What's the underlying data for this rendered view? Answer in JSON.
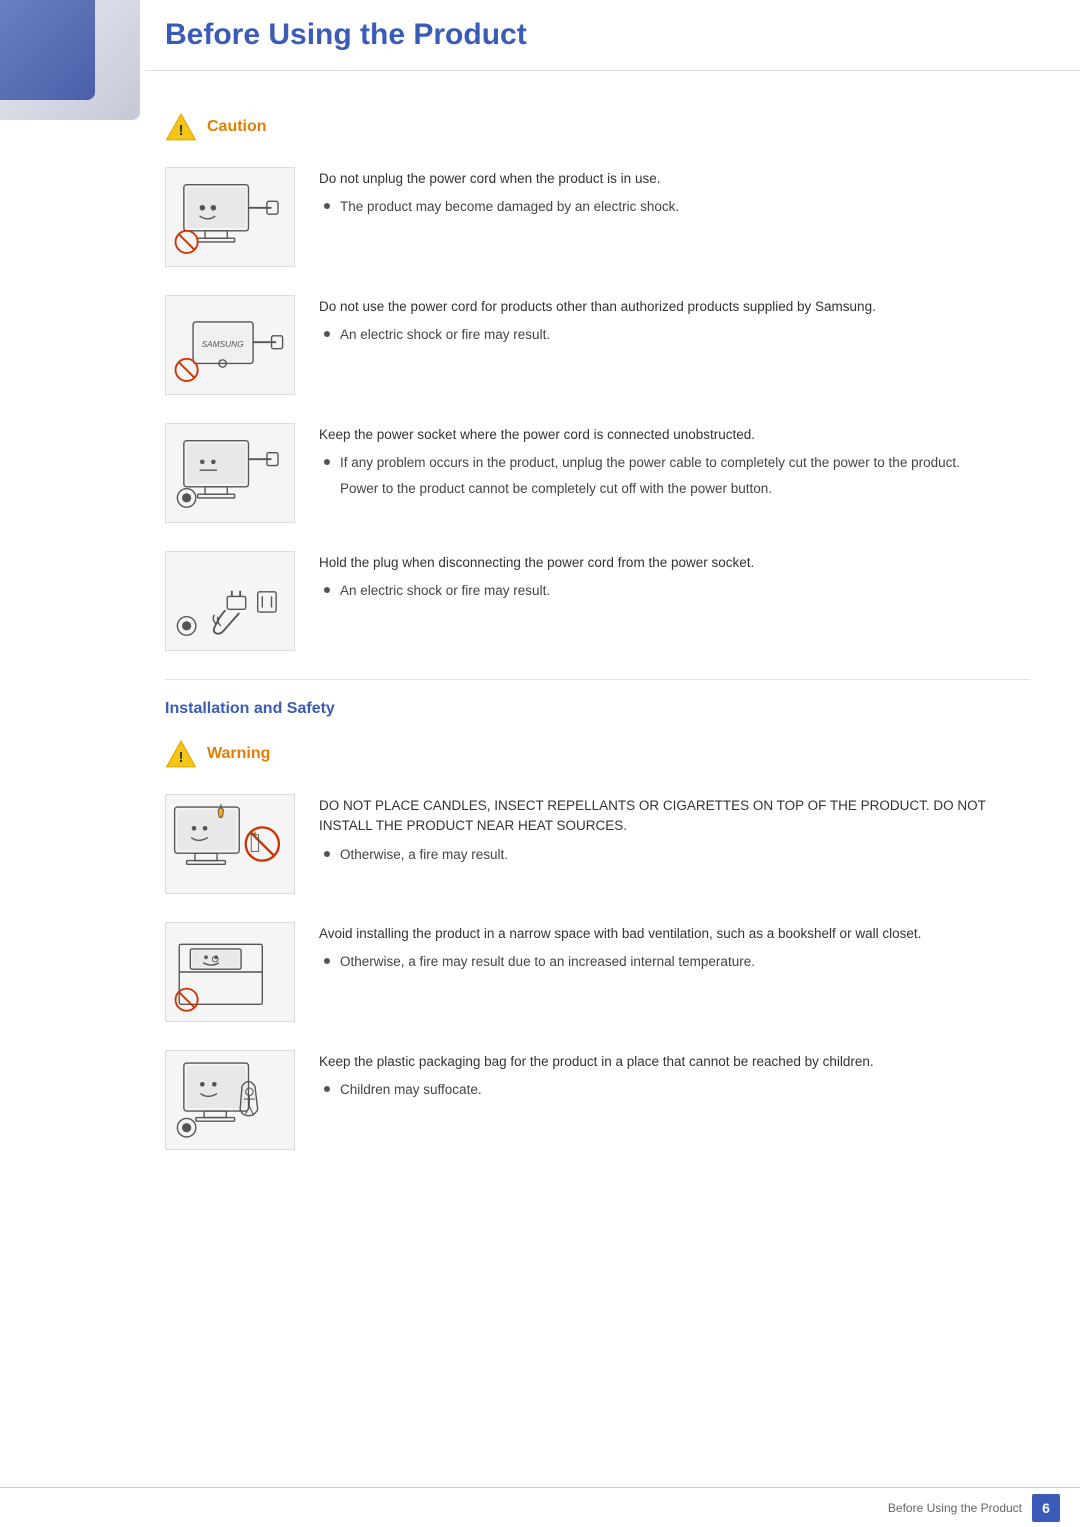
{
  "page": {
    "title": "Before Using the Product",
    "footer_text": "Before Using the Product",
    "page_number": "6"
  },
  "caution_section": {
    "label": "Caution",
    "items": [
      {
        "main_text": "Do not unplug the power cord when the product is in use.",
        "bullets": [
          "The product may become damaged by an electric shock."
        ],
        "sub_notes": []
      },
      {
        "main_text": "Do not use the power cord for products other than authorized products supplied by Samsung.",
        "bullets": [
          "An electric shock or fire may result."
        ],
        "sub_notes": []
      },
      {
        "main_text": "Keep the power socket where the power cord is connected unobstructed.",
        "bullets": [
          "If any problem occurs in the product, unplug the power cable to completely cut the power to the product."
        ],
        "sub_notes": [
          "Power to the product cannot be completely cut off with the power button."
        ]
      },
      {
        "main_text": "Hold the plug when disconnecting the power cord from the power socket.",
        "bullets": [
          "An electric shock or fire may result."
        ],
        "sub_notes": []
      }
    ]
  },
  "installation_heading": "Installation and Safety",
  "warning_section": {
    "label": "Warning",
    "items": [
      {
        "main_text": "DO NOT PLACE CANDLES, INSECT REPELLANTS OR CIGARETTES ON TOP OF THE PRODUCT. DO NOT INSTALL THE PRODUCT NEAR HEAT SOURCES.",
        "bullets": [
          "Otherwise, a fire may result."
        ],
        "sub_notes": []
      },
      {
        "main_text": "Avoid installing the product in a narrow space with bad ventilation, such as a bookshelf or wall closet.",
        "bullets": [
          "Otherwise, a fire may result due to an increased internal temperature."
        ],
        "sub_notes": []
      },
      {
        "main_text": "Keep the plastic packaging bag for the product in a place that cannot be reached by children.",
        "bullets": [
          "Children may suffocate."
        ],
        "sub_notes": []
      }
    ]
  }
}
